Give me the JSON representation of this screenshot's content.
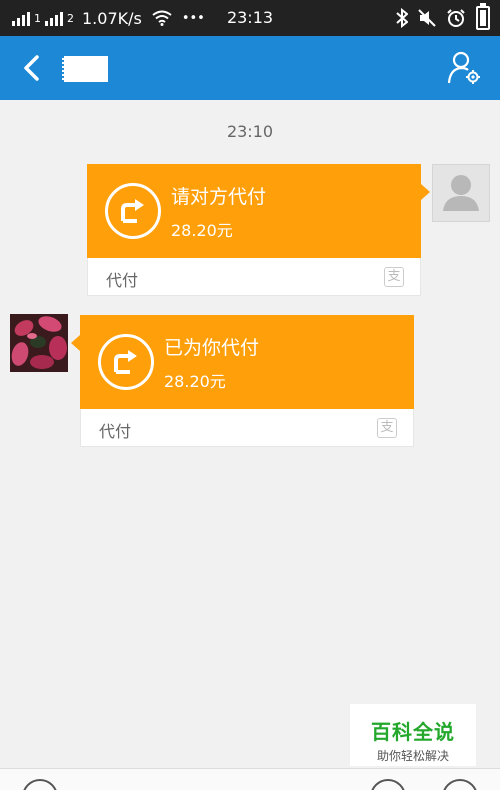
{
  "status_bar": {
    "network_speed": "1.07K/s",
    "wifi_icon": "wifi-icon",
    "more": "•••",
    "time": "23:13"
  },
  "header": {
    "contact_name": "",
    "back_icon": "back-arrow-icon",
    "profile_icon": "profile-settings-icon",
    "bar_color": "#1c88d6"
  },
  "chat": {
    "timestamp": "23:10",
    "messages": [
      {
        "sender": "self",
        "title": "请对方代付",
        "amount": "28.20元",
        "label": "代付",
        "badge": "支"
      },
      {
        "sender": "other",
        "title": "已为你代付",
        "amount": "28.20元",
        "label": "代付",
        "badge": "支"
      }
    ],
    "card_color": "#ff9f0a"
  },
  "watermark": {
    "name": "百科全说",
    "slogan": "助你轻松解决"
  }
}
